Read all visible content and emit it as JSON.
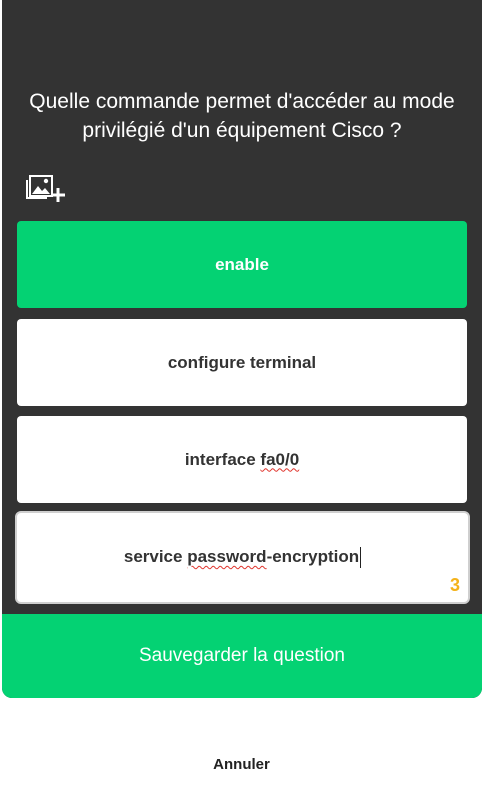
{
  "question": {
    "text": "Quelle commande permet d'accéder au mode privilégié d'un équipement Cisco ?"
  },
  "icons": {
    "add_image": "add-image-icon"
  },
  "answers": [
    {
      "label": "enable",
      "correct": true
    },
    {
      "label": "configure terminal",
      "correct": false
    },
    {
      "label_before": "interface ",
      "label_misspelled": "fa0/0",
      "label_after": "",
      "correct": false
    },
    {
      "label_before": "service ",
      "label_misspelled": "password",
      "label_after": "-encryption",
      "correct": false,
      "editing": true,
      "remaining_chars": "3"
    }
  ],
  "actions": {
    "save_label": "Sauvegarder la question",
    "cancel_label": "Annuler"
  },
  "colors": {
    "card_background": "#333333",
    "accent_green": "#04d273",
    "counter_yellow": "#f4b21a"
  }
}
